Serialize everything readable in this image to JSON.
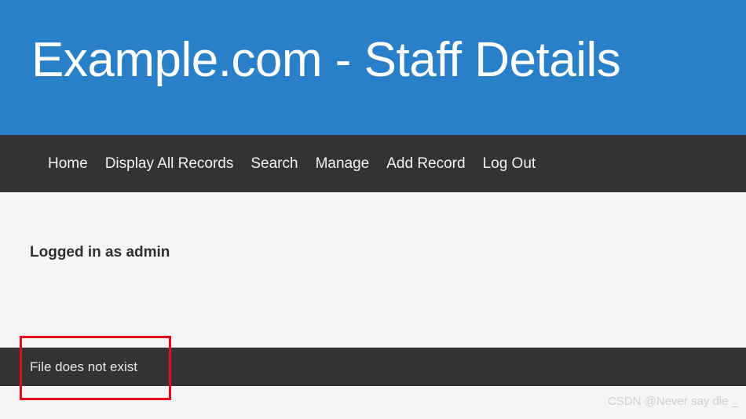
{
  "header": {
    "title": "Example.com - Staff Details",
    "background_color": "#2980c8",
    "text_color": "#ffffff"
  },
  "nav": {
    "background_color": "#333333",
    "text_color": "#f2f2f2",
    "items": [
      {
        "label": "Home"
      },
      {
        "label": "Display All Records"
      },
      {
        "label": "Search"
      },
      {
        "label": "Manage"
      },
      {
        "label": "Add Record"
      },
      {
        "label": "Log Out"
      }
    ]
  },
  "content": {
    "background_color": "#f5f5f5",
    "login_status": "Logged in as admin"
  },
  "message_bar": {
    "background_color": "#333333",
    "text": "File does not exist",
    "text_color": "#e8e8e8"
  },
  "annotation": {
    "border_color": "#e60b18",
    "target": "File does not exist"
  },
  "watermark": {
    "text": "CSDN @Never say die _",
    "color": "#cfcfcf"
  }
}
